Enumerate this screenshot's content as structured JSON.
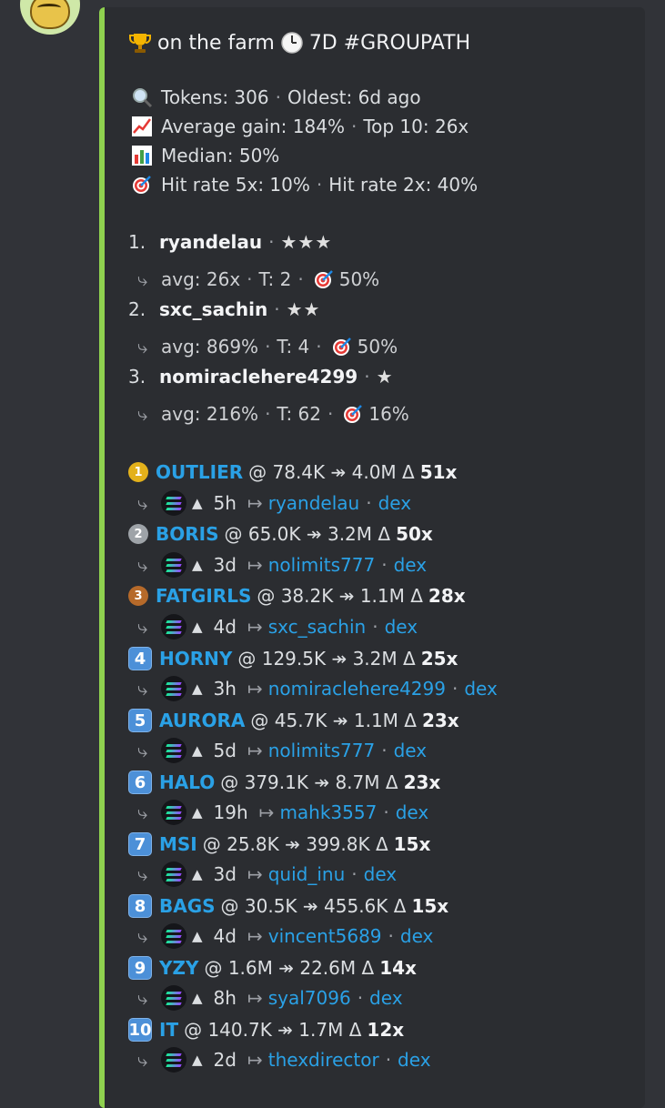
{
  "header": {
    "title_text": "on the farm",
    "title_suffix": "7D #GROUPATH",
    "title_icons": [
      "trophy-icon",
      "clock-icon"
    ]
  },
  "stats": {
    "tokens_label": "Tokens: 306",
    "oldest_label": "Oldest: 6d ago",
    "avg_gain_label": "Average gain: 184%",
    "top10_label": "Top 10: 26x",
    "median_label": "Median: 50%",
    "hit5_label": "Hit rate 5x: 10%",
    "hit2_label": "Hit rate 2x: 40%"
  },
  "leaders": [
    {
      "rank": "1.",
      "name": "ryandelau",
      "stars": "★★★",
      "avg": "avg: 26x",
      "t": "T: 2",
      "hit": "50%"
    },
    {
      "rank": "2.",
      "name": "sxc_sachin",
      "stars": "★★",
      "avg": "avg: 869%",
      "t": "T: 4",
      "hit": "50%"
    },
    {
      "rank": "3.",
      "name": "nomiraclehere4299",
      "stars": "★",
      "avg": "avg: 216%",
      "t": "T: 62",
      "hit": "16%"
    }
  ],
  "calls": [
    {
      "badge": "gold-medal",
      "badge_text": "1",
      "token": "OUTLIER",
      "from_to": "@ 78.4K ↠ 4.0M Δ",
      "mult": "51x",
      "age": "5h",
      "caller": "ryandelau",
      "link": "dex"
    },
    {
      "badge": "silver-medal",
      "badge_text": "2",
      "token": "BORIS",
      "from_to": "@ 65.0K ↠ 3.2M Δ",
      "mult": "50x",
      "age": "3d",
      "caller": "nolimits777",
      "link": "dex"
    },
    {
      "badge": "bronze-medal",
      "badge_text": "3",
      "token": "FATGIRLS",
      "from_to": "@ 38.2K ↠ 1.1M Δ",
      "mult": "28x",
      "age": "4d",
      "caller": "sxc_sachin",
      "link": "dex"
    },
    {
      "badge": "keycap",
      "badge_text": "4",
      "token": "HORNY",
      "from_to": "@ 129.5K ↠ 3.2M Δ",
      "mult": "25x",
      "age": "3h",
      "caller": "nomiraclehere4299",
      "link": "dex"
    },
    {
      "badge": "keycap",
      "badge_text": "5",
      "token": "AURORA",
      "from_to": "@ 45.7K ↠ 1.1M Δ",
      "mult": "23x",
      "age": "5d",
      "caller": "nolimits777",
      "link": "dex"
    },
    {
      "badge": "keycap",
      "badge_text": "6",
      "token": "HALO",
      "from_to": "@ 379.1K ↠ 8.7M Δ",
      "mult": "23x",
      "age": "19h",
      "caller": "mahk3557",
      "link": "dex"
    },
    {
      "badge": "keycap",
      "badge_text": "7",
      "token": "MSI",
      "from_to": "@ 25.8K ↠ 399.8K Δ",
      "mult": "15x",
      "age": "3d",
      "caller": "quid_inu",
      "link": "dex"
    },
    {
      "badge": "keycap",
      "badge_text": "8",
      "token": "BAGS",
      "from_to": "@ 30.5K ↠ 455.6K Δ",
      "mult": "15x",
      "age": "4d",
      "caller": "vincent5689",
      "link": "dex"
    },
    {
      "badge": "keycap",
      "badge_text": "9",
      "token": "YZY",
      "from_to": "@ 1.6M ↠ 22.6M Δ",
      "mult": "14x",
      "age": "8h",
      "caller": "syal7096",
      "link": "dex"
    },
    {
      "badge": "keycap",
      "badge_text": "10",
      "token": "IT",
      "from_to": "@ 140.7K ↠ 1.7M Δ",
      "mult": "12x",
      "age": "2d",
      "caller": "thexdirector",
      "link": "dex"
    }
  ],
  "colors": {
    "accent_bar": "#8fd14f",
    "link": "#2aa1e6",
    "embed_bg": "#2b2d31",
    "page_bg": "#313338"
  }
}
